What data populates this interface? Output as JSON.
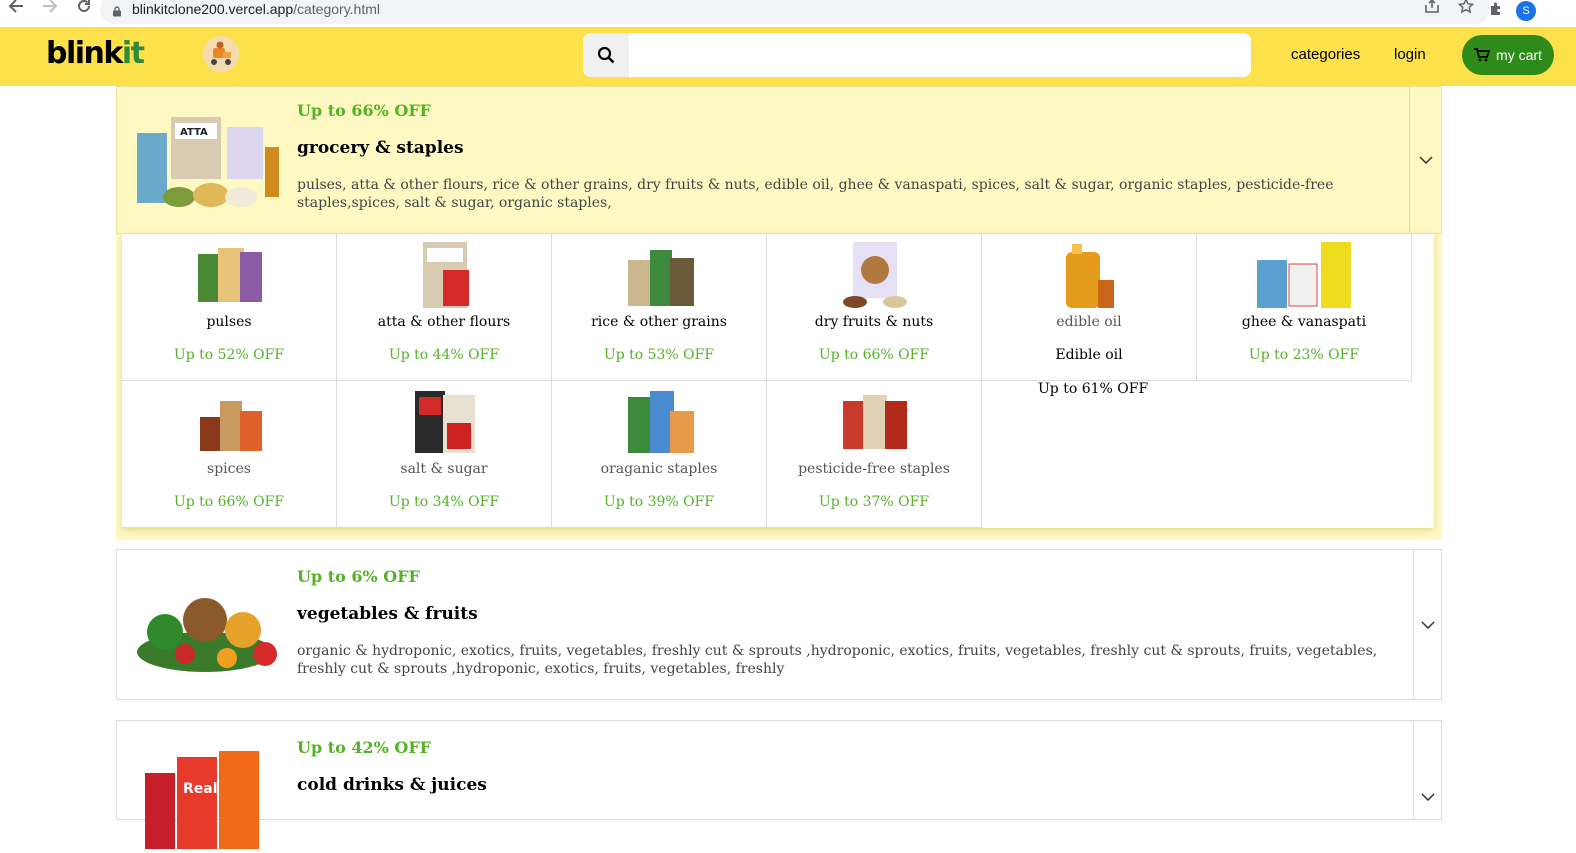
{
  "browser": {
    "url_host": "blinkitclone200.vercel.app",
    "url_path": "/category.html",
    "profile_initial": "S"
  },
  "header": {
    "logo_main": "blink",
    "logo_accent": "it",
    "search_placeholder": "",
    "links": [
      "categories",
      "login"
    ],
    "cart_label": "my cart"
  },
  "categories": [
    {
      "offer": "Up to 66% OFF",
      "title": "grocery & staples",
      "desc": "pulses, atta & other flours, rice & other grains, dry fruits & nuts, edible oil, ghee & vanaspati, spices, salt & sugar, organic staples, pesticide-free staples,spices, salt & sugar, organic staples,"
    },
    {
      "offer": "Up to 6% OFF",
      "title": "vegetables & fruits",
      "desc": "organic & hydroponic, exotics, fruits, vegetables, freshly cut & sprouts ,hydroponic, exotics, fruits, vegetables, freshly cut & sprouts, fruits, vegetables, freshly cut & sprouts ,hydroponic, exotics, fruits, vegetables, freshly"
    },
    {
      "offer": "Up to 42% OFF",
      "title": "cold drinks & juices",
      "desc": ""
    }
  ],
  "subcategories": [
    {
      "name": "pulses",
      "offer": "Up to 52% OFF"
    },
    {
      "name": "atta & other flours",
      "offer": "Up to 44% OFF"
    },
    {
      "name": "rice & other grains",
      "offer": "Up to 53% OFF"
    },
    {
      "name": "dry fruits & nuts",
      "offer": "Up to 66% OFF"
    },
    {
      "name": "edible oil",
      "offer": "Edible oil",
      "extra": "Up to 61% OFF"
    },
    {
      "name": "ghee & vanaspati",
      "offer": "Up to 23% OFF"
    },
    {
      "name": "spices",
      "offer": "Up to 66% OFF"
    },
    {
      "name": "salt & sugar",
      "offer": "Up to 34% OFF"
    },
    {
      "name": "oraganic staples",
      "offer": "Up to 39% OFF"
    },
    {
      "name": "pesticide-free staples",
      "offer": "Up to 37% OFF"
    }
  ],
  "colors": {
    "header_bg": "#fce14b",
    "accent_green": "#54b226",
    "cart_bg": "#2e8b1a",
    "active_card_bg": "#fef9c3"
  },
  "icons": [
    "back-arrow-icon",
    "forward-arrow-icon",
    "reload-icon",
    "lock-icon",
    "share-icon",
    "star-icon",
    "puzzle-icon",
    "search-icon",
    "cart-icon",
    "chevron-down-icon"
  ]
}
